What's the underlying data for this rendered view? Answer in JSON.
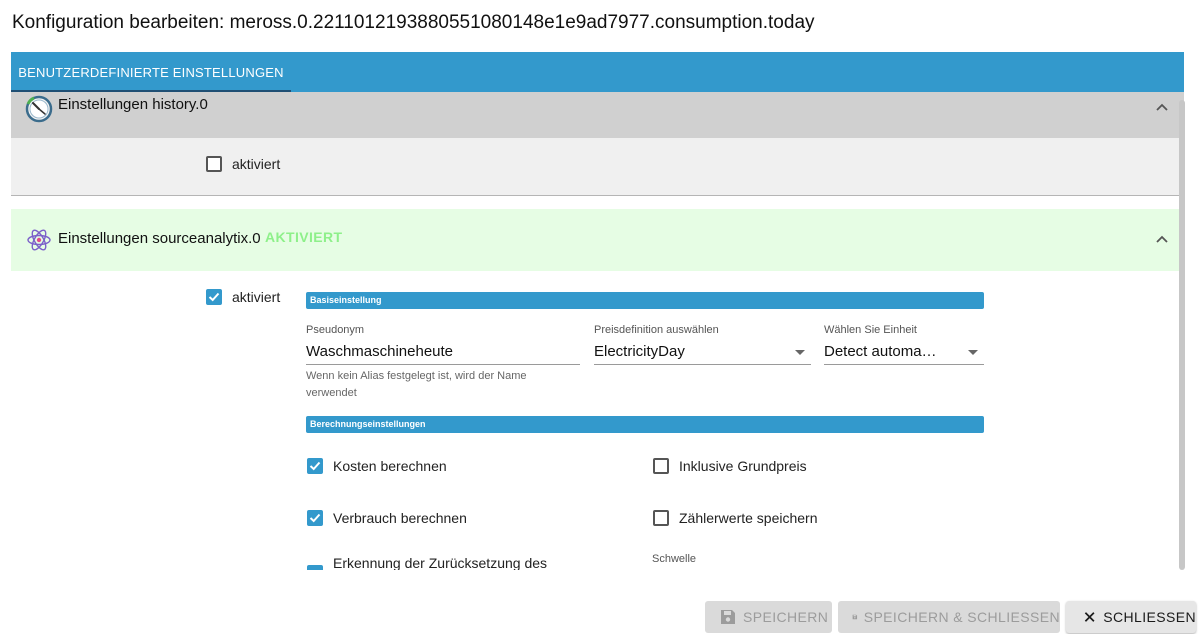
{
  "dialog": {
    "title": "Konfiguration bearbeiten: meross.0.2211012193880551080148e1e9ad7977.consumption.today"
  },
  "tabs": [
    {
      "label": "BENUTZERDEFINIERTE EINSTELLUNGEN",
      "active": true
    }
  ],
  "panels": {
    "history": {
      "title": "Einstellungen history.0",
      "icon": "clock-icon",
      "enabled_label": "aktiviert",
      "enabled": false
    },
    "sourceanalytix": {
      "title": "Einstellungen sourceanalytix.0",
      "badge": "AKTIVIERT",
      "icon": "atom-icon",
      "enabled_label": "aktiviert",
      "enabled": true,
      "basic_section": "Basiseinstellung",
      "pseudonym": {
        "label": "Pseudonym",
        "value": "Waschmaschineheute",
        "helper": "Wenn kein Alias festgelegt ist, wird der Name verwendet"
      },
      "price_definition": {
        "label": "Preisdefinition auswählen",
        "value": "ElectricityDay"
      },
      "unit": {
        "label": "Wählen Sie Einheit",
        "value": "Detect automa…"
      },
      "calc_section": "Berechnungseinstellungen",
      "checkboxes": {
        "calc_cost": {
          "label": "Kosten berechnen",
          "checked": true
        },
        "incl_base_price": {
          "label": "Inklusive Grundpreis",
          "checked": false
        },
        "calc_consumption": {
          "label": "Verbrauch berechnen",
          "checked": true
        },
        "save_meter_values": {
          "label": "Zählerwerte speichern",
          "checked": false
        },
        "reset_detection": {
          "label": "Erkennung der Zurücksetzung des",
          "checked": true
        }
      },
      "threshold_label": "Schwelle"
    }
  },
  "footer": {
    "save": "SPEICHERN",
    "save_close": "SPEICHERN & SCHLIESSEN",
    "close": "SCHLIESSEN"
  },
  "colors": {
    "accent": "#3399cc",
    "active_badge": "#8ef08a",
    "green_header": "#e6fde4",
    "gray_header": "#d0d0d0"
  }
}
